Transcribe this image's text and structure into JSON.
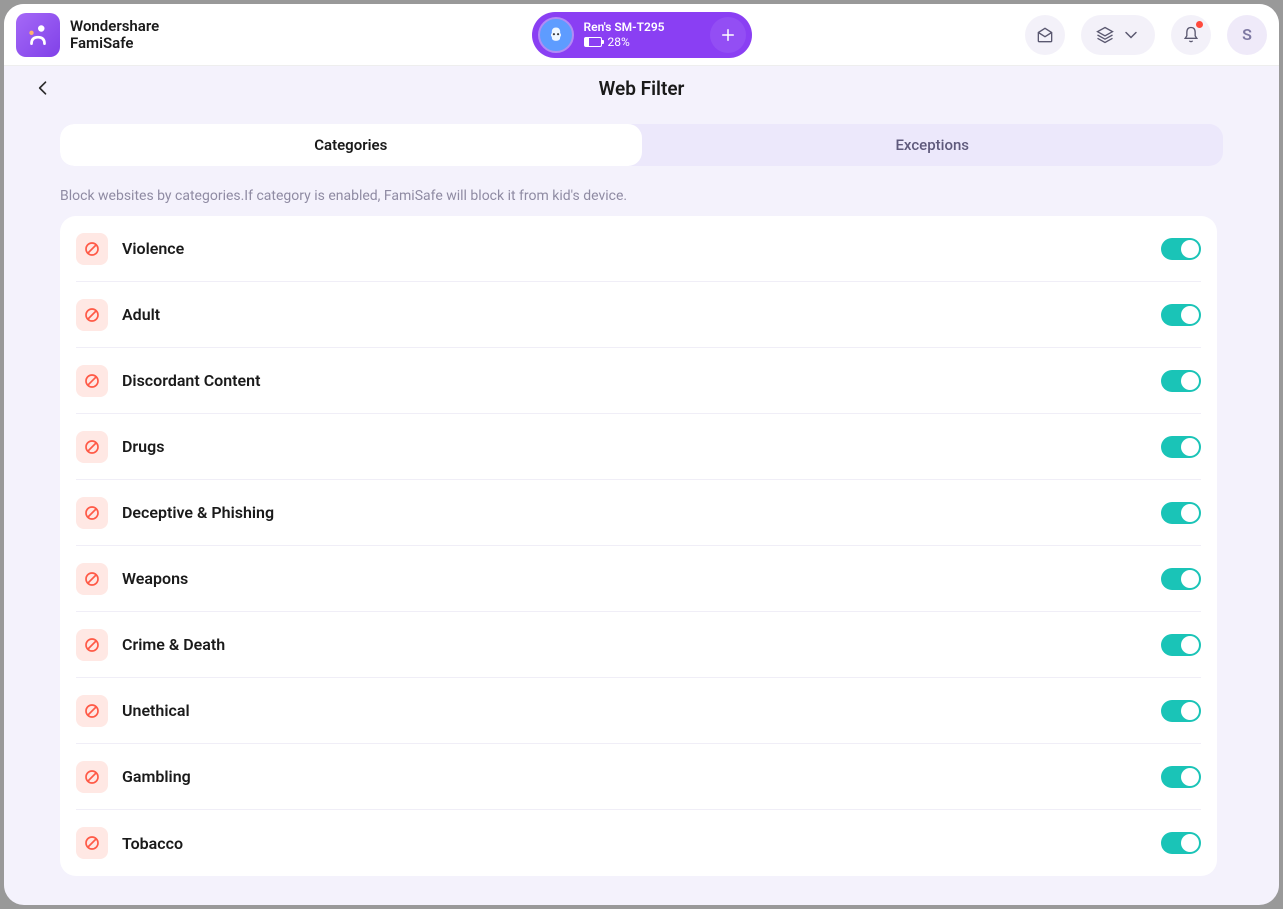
{
  "header": {
    "brand_top": "Wondershare",
    "brand_bottom": "FamiSafe",
    "device_name": "Ren's SM-T295",
    "battery_pct": "28%",
    "avatar_initial": "S"
  },
  "page": {
    "title": "Web Filter",
    "tabs": {
      "categories": "Categories",
      "exceptions": "Exceptions"
    },
    "description": "Block websites by categories.If category is enabled, FamiSafe will block it from kid's device."
  },
  "categories": [
    {
      "label": "Violence",
      "enabled": true
    },
    {
      "label": "Adult",
      "enabled": true
    },
    {
      "label": "Discordant Content",
      "enabled": true
    },
    {
      "label": "Drugs",
      "enabled": true
    },
    {
      "label": "Deceptive & Phishing",
      "enabled": true
    },
    {
      "label": "Weapons",
      "enabled": true
    },
    {
      "label": "Crime & Death",
      "enabled": true
    },
    {
      "label": "Unethical",
      "enabled": true
    },
    {
      "label": "Gambling",
      "enabled": true
    },
    {
      "label": "Tobacco",
      "enabled": true
    }
  ]
}
